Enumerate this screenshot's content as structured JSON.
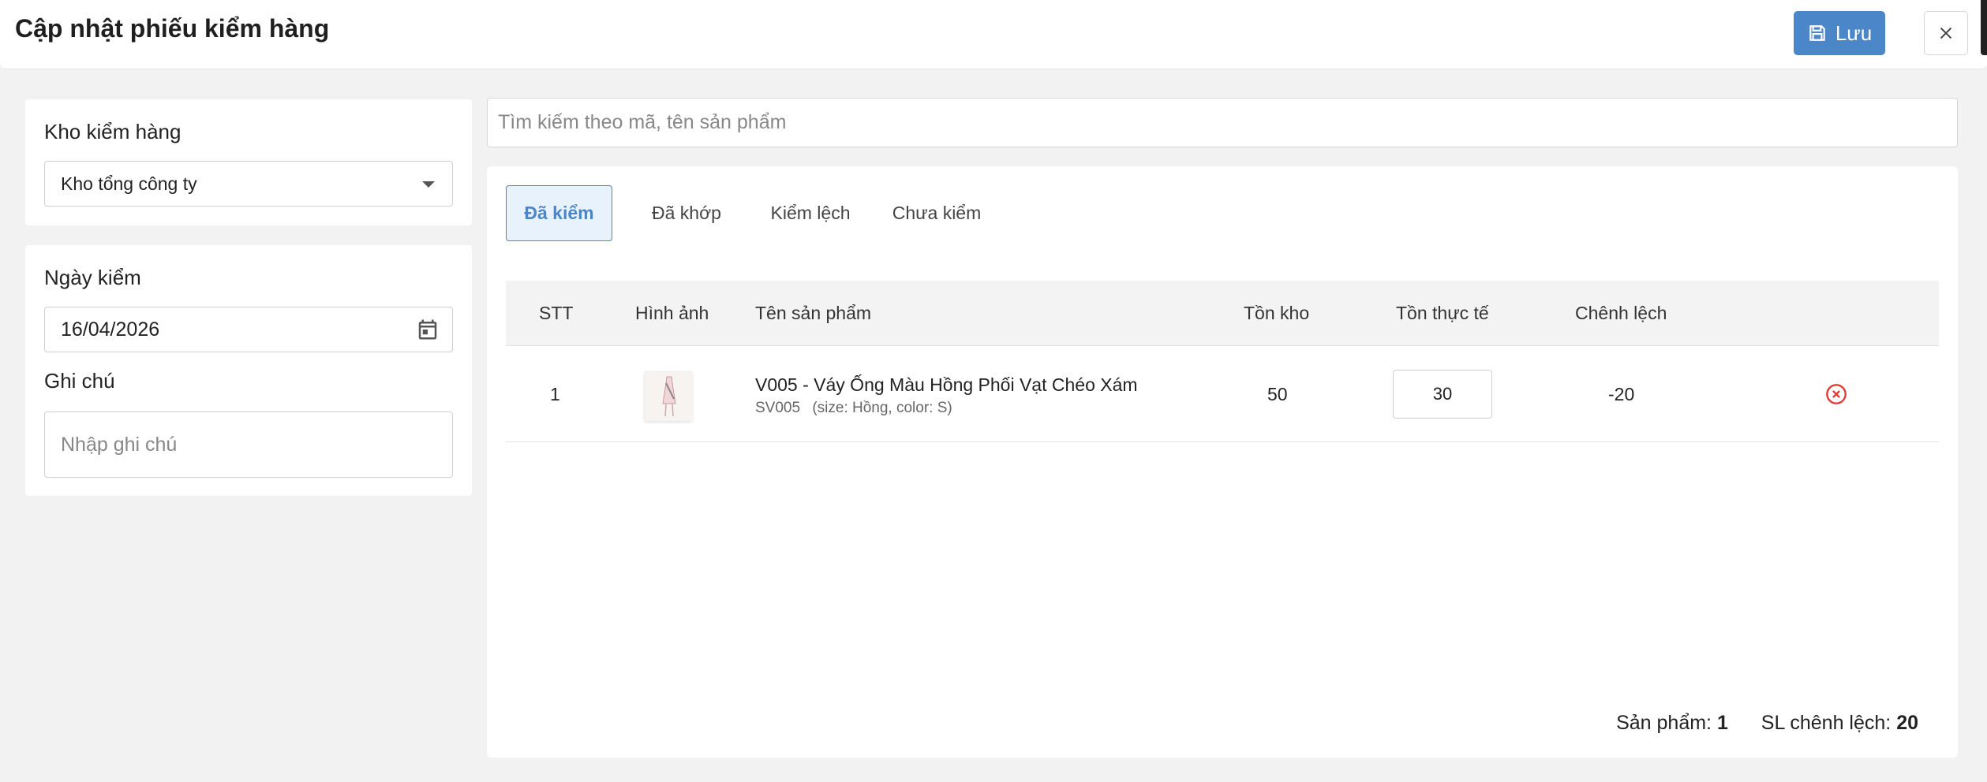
{
  "header": {
    "title": "Cập nhật phiếu kiểm hàng",
    "save_label": "Lưu",
    "save_icon": "save-icon",
    "close_icon": "close-icon"
  },
  "left": {
    "warehouse_label": "Kho kiểm hàng",
    "warehouse_value": "Kho tổng công ty",
    "date_label": "Ngày kiểm",
    "date_value": "16/04/2026",
    "note_label": "Ghi chú",
    "note_placeholder": "Nhập ghi chú"
  },
  "search": {
    "placeholder": "Tìm kiếm theo mã, tên sản phẩm"
  },
  "tabs": [
    {
      "label": "Đã kiểm",
      "active": true
    },
    {
      "label": "Đã khớp",
      "active": false
    },
    {
      "label": "Kiểm lệch",
      "active": false
    },
    {
      "label": "Chưa kiểm",
      "active": false
    }
  ],
  "table": {
    "columns": [
      "STT",
      "Hình ảnh",
      "Tên sản phẩm",
      "Tồn kho",
      "Tồn thực tế",
      "Chênh lệch"
    ],
    "rows": [
      {
        "stt": "1",
        "name": "V005 - Váy Ống Màu Hồng Phối Vạt Chéo Xám",
        "sku": "SV005",
        "variant": "(size: Hồng, color: S)",
        "stock": "50",
        "actual": "30",
        "diff": "-20"
      }
    ]
  },
  "summary": {
    "products_label": "Sản phẩm:",
    "products_value": "1",
    "diff_label": "SL chênh lệch:",
    "diff_value": "20"
  },
  "colors": {
    "accent": "#4a86c8",
    "danger": "#e53935"
  }
}
